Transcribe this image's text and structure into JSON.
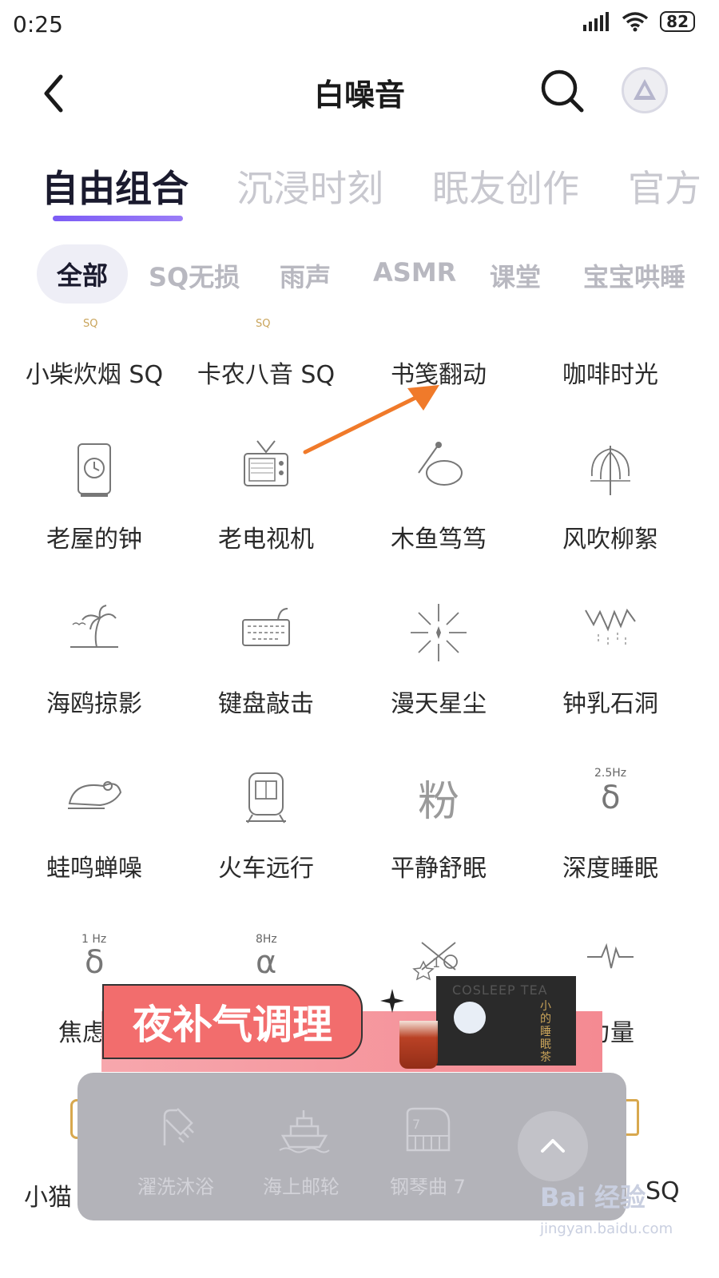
{
  "status_bar": {
    "time": "0:25",
    "battery": "82"
  },
  "header": {
    "title": "白噪音"
  },
  "tabs": [
    {
      "label": "自由组合",
      "active": true
    },
    {
      "label": "沉浸时刻",
      "active": false
    },
    {
      "label": "眠友创作",
      "active": false
    },
    {
      "label": "官方",
      "active": false
    }
  ],
  "chips": [
    {
      "label": "全部",
      "active": true
    },
    {
      "label": "SQ无损"
    },
    {
      "label": "雨声"
    },
    {
      "label": "ASMR"
    },
    {
      "label": "课堂"
    },
    {
      "label": "宝宝哄睡"
    }
  ],
  "sounds": {
    "row0": [
      "小柴炊烟 SQ",
      "卡农八音 SQ",
      "书笺翻动",
      "咖啡时光"
    ],
    "row1": [
      {
        "label": "老屋的钟",
        "icon": "clock-icon"
      },
      {
        "label": "老电视机",
        "icon": "tv-icon"
      },
      {
        "label": "木鱼笃笃",
        "icon": "wooden-fish-icon"
      },
      {
        "label": "风吹柳絮",
        "icon": "willow-icon"
      }
    ],
    "row2": [
      {
        "label": "海鸥掠影",
        "icon": "palm-island-icon"
      },
      {
        "label": "键盘敲击",
        "icon": "keyboard-icon"
      },
      {
        "label": "漫天星尘",
        "icon": "star-burst-icon"
      },
      {
        "label": "钟乳石洞",
        "icon": "cave-icon"
      }
    ],
    "row3": [
      {
        "label": "蛙鸣蝉噪",
        "icon": "frog-icon"
      },
      {
        "label": "火车远行",
        "icon": "train-icon"
      },
      {
        "label": "平静舒眠",
        "icon": "fen-character-icon",
        "glyph": "粉"
      },
      {
        "label": "深度睡眠",
        "icon": "delta-wave-icon",
        "hz": "2.5Hz",
        "glyph": "δ"
      }
    ],
    "row4": [
      {
        "label": "焦虑缓",
        "icon": "delta-wave-icon",
        "hz": "1 Hz",
        "glyph": "δ"
      },
      {
        "label": "",
        "icon": "alpha-wave-icon",
        "hz": "8Hz",
        "glyph": "α"
      },
      {
        "label": "",
        "icon": "zodiac-icon",
        "glyph": "1"
      },
      {
        "label": "力量",
        "icon": "pulse-icon"
      }
    ],
    "row5": [
      {
        "label": "小猫"
      },
      {
        "label": "SQ"
      }
    ],
    "sq_mark": "SQ"
  },
  "banner": {
    "text": "夜补气调理",
    "brand": "COSLEEP TEA",
    "product": "小的睡眠茶"
  },
  "player": {
    "items": [
      {
        "label": "濯洗沐浴",
        "icon": "shower-icon"
      },
      {
        "label": "海上邮轮",
        "icon": "cruise-ship-icon"
      },
      {
        "label": "钢琴曲 7",
        "icon": "piano-icon",
        "badge": "7"
      }
    ]
  },
  "watermark": {
    "text": "Bai 经验",
    "sub": "jingyan.baidu.com"
  },
  "colors": {
    "accent": "#7c5cf5",
    "banner": "#f26d6d",
    "arrow": "#f07a2a"
  }
}
